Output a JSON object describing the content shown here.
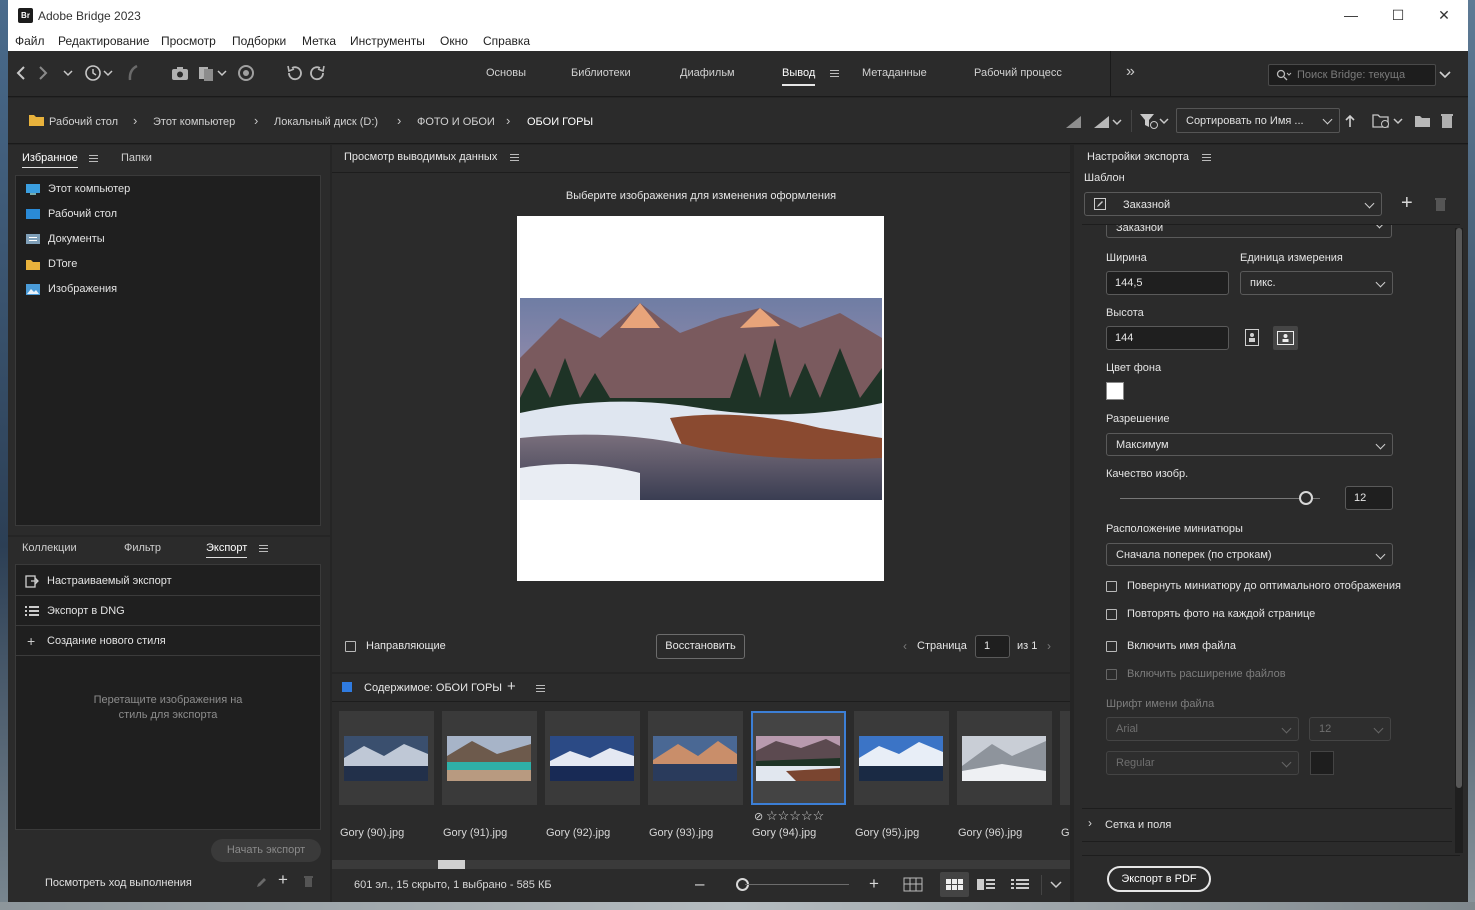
{
  "app": {
    "title": "Adobe Bridge 2023",
    "icon_label": "Br",
    "window_controls": [
      "minimize-icon",
      "maximize-icon",
      "close-icon"
    ]
  },
  "menu": [
    "Файл",
    "Редактирование",
    "Просмотр",
    "Подборки",
    "Метка",
    "Инструменты",
    "Окно",
    "Справка"
  ],
  "workspaces": {
    "items": [
      "Основы",
      "Библиотеки",
      "Диафильм",
      "Вывод",
      "Метаданные",
      "Рабочий процесс"
    ],
    "active": "Вывод",
    "more": "»"
  },
  "search": {
    "placeholder": "Поиск Bridge: текуща"
  },
  "breadcrumb": [
    "Рабочий стол",
    "Этот компьютер",
    "Локальный диск (D:)",
    "ФОТО И ОБОИ",
    "ОБОИ ГОРЫ"
  ],
  "sort": {
    "label": "Сортировать по Имя ..."
  },
  "favorites_panel": {
    "tabs": [
      "Избранное",
      "Папки"
    ],
    "active_tab": "Избранное",
    "items": [
      {
        "label": "Этот компьютер",
        "icon": "computer-icon"
      },
      {
        "label": "Рабочий стол",
        "icon": "desktop-icon"
      },
      {
        "label": "Документы",
        "icon": "documents-icon"
      },
      {
        "label": "DTore",
        "icon": "folder-icon"
      },
      {
        "label": "Изображения",
        "icon": "pictures-icon"
      }
    ]
  },
  "export_panel": {
    "tabs": [
      "Коллекции",
      "Фильтр",
      "Экспорт"
    ],
    "active_tab": "Экспорт",
    "items": [
      {
        "label": "Настраиваемый экспорт",
        "icon": "custom-export-icon"
      },
      {
        "label": "Экспорт в DNG",
        "icon": "list-icon"
      },
      {
        "label": "Создание нового стиля",
        "icon": "plus-icon"
      }
    ],
    "drop_hint_line1": "Перетащите изображения на",
    "drop_hint_line2": "стиль для экспорта",
    "start_button": "Начать экспорт",
    "progress_link": "Посмотреть ход выполнения"
  },
  "preview": {
    "title": "Просмотр выводимых данных",
    "hint": "Выберите изображения для изменения оформления",
    "guides_label": "Направляющие",
    "guides_checked": false,
    "restore_button": "Восстановить",
    "page_label": "Страница",
    "page_value": "1",
    "page_of": "из 1"
  },
  "content": {
    "title": "Содержимое: ОБОИ ГОРЫ",
    "accent": "#2f7be0",
    "thumbs": [
      {
        "name": "Gory (90).jpg",
        "selected": false
      },
      {
        "name": "Gory (91).jpg",
        "selected": false
      },
      {
        "name": "Gory (92).jpg",
        "selected": false
      },
      {
        "name": "Gory (93).jpg",
        "selected": false
      },
      {
        "name": "Gory (94).jpg",
        "selected": true,
        "rating": "☆☆☆☆☆"
      },
      {
        "name": "Gory (95).jpg",
        "selected": false
      },
      {
        "name": "Gory (96).jpg",
        "selected": false
      },
      {
        "name": "G",
        "selected": false
      }
    ],
    "status": "601 эл., 15 скрыто, 1 выбрано - 585 КБ",
    "zoom": 0.1
  },
  "export_settings": {
    "title": "Настройки экспорта",
    "template_label": "Шаблон",
    "template_value": "Заказной",
    "partial_value": "Заказной",
    "width_label": "Ширина",
    "width_value": "144,5",
    "unit_label": "Единица измерения",
    "unit_value": "пикс.",
    "height_label": "Высота",
    "height_value": "144",
    "bg_label": "Цвет фона",
    "bg_color": "#ffffff",
    "resolution_label": "Разрешение",
    "resolution_value": "Максимум",
    "quality_label": "Качество изобр.",
    "quality_value": "12",
    "quality_level": 0.93,
    "layout_label": "Расположение миниатюры",
    "layout_value": "Сначала поперек (по строкам)",
    "checks": [
      {
        "label": "Повернуть миниатюру до оптимального отображения",
        "enabled": true
      },
      {
        "label": "Повторять фото на каждой странице",
        "enabled": true
      },
      {
        "label": "Включить имя файла",
        "enabled": true
      },
      {
        "label": "Включить расширение файлов",
        "enabled": false
      }
    ],
    "font_label": "Шрифт имени файла",
    "font_family": "Arial",
    "font_size": "12",
    "font_style": "Regular",
    "section_grid": "Сетка и поля",
    "export_pdf_button": "Экспорт в PDF"
  }
}
